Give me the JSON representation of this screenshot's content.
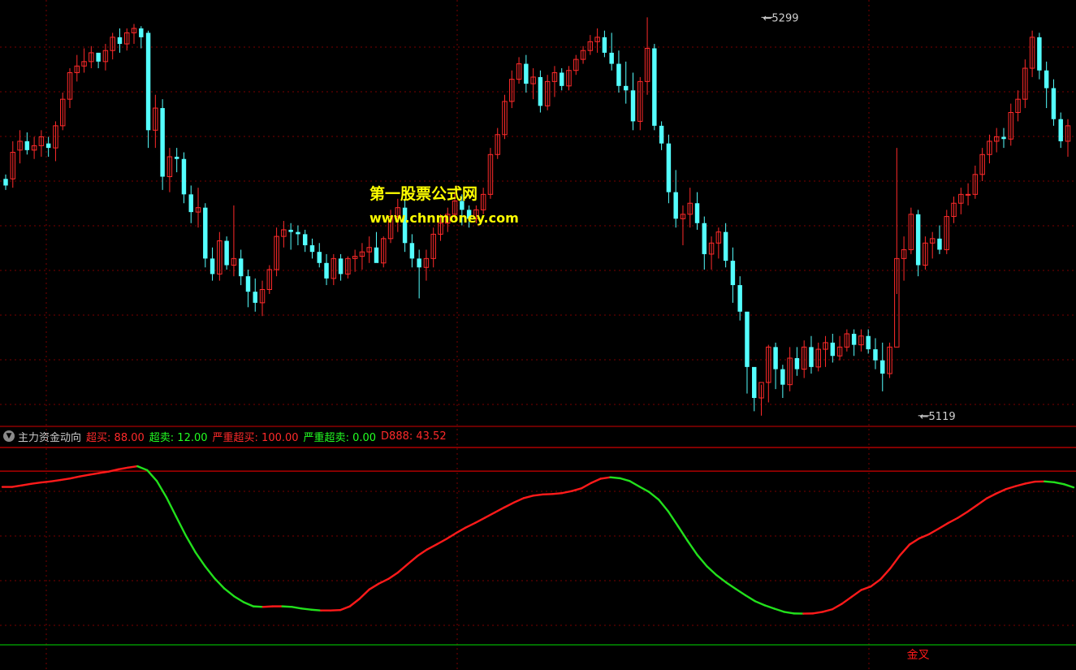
{
  "indicator": {
    "name": "主力资金动向",
    "items": [
      {
        "label": "超买",
        "value": "88.00",
        "color": "#ff2a2a"
      },
      {
        "label": "超卖",
        "value": "12.00",
        "color": "#22ff22"
      },
      {
        "label": "严重超买",
        "value": "100.00",
        "color": "#ff2a2a"
      },
      {
        "label": "严重超卖",
        "value": "0.00",
        "color": "#22ff22"
      },
      {
        "label": "D888",
        "value": "43.52",
        "color": "#ff2a2a"
      }
    ]
  },
  "watermark": {
    "line1": "第一股票公式网",
    "line2": "www.chnmoney.com"
  },
  "colors": {
    "up": "#ff2a2a",
    "down": "#54ffff",
    "osc_up": "#ff1a1a",
    "osc_down": "#22e01c",
    "grid": "#7a0000",
    "band_red": "#d00000",
    "band_green": "#00b000",
    "highlight": "#ffff00"
  },
  "chart_data": [
    {
      "type": "candlestick",
      "title": "",
      "annotations": [
        {
          "label": "5299",
          "value": 5299,
          "kind": "high",
          "index": 106
        },
        {
          "label": "5119",
          "value": 5119,
          "kind": "low",
          "index": 128
        }
      ],
      "ylim": [
        5116,
        5305
      ],
      "grid": true,
      "ohlc": [
        [
          5226,
          5228,
          5221,
          5223
        ],
        [
          5226,
          5243,
          5222,
          5238
        ],
        [
          5239,
          5248,
          5233,
          5243
        ],
        [
          5243,
          5247,
          5237,
          5239
        ],
        [
          5239,
          5245,
          5235,
          5241
        ],
        [
          5241,
          5248,
          5236,
          5245
        ],
        [
          5242,
          5245,
          5236,
          5240
        ],
        [
          5240,
          5252,
          5234,
          5250
        ],
        [
          5250,
          5265,
          5248,
          5262
        ],
        [
          5262,
          5276,
          5258,
          5274
        ],
        [
          5274,
          5282,
          5270,
          5277
        ],
        [
          5277,
          5285,
          5274,
          5279
        ],
        [
          5279,
          5286,
          5276,
          5283
        ],
        [
          5283,
          5283,
          5276,
          5279
        ],
        [
          5279,
          5287,
          5275,
          5284
        ],
        [
          5284,
          5292,
          5280,
          5290
        ],
        [
          5290,
          5294,
          5283,
          5287
        ],
        [
          5287,
          5294,
          5284,
          5292
        ],
        [
          5292,
          5296,
          5287,
          5294
        ],
        [
          5294,
          5295,
          5285,
          5290
        ],
        [
          5292,
          5293,
          5240,
          5248
        ],
        [
          5248,
          5264,
          5240,
          5258
        ],
        [
          5258,
          5262,
          5221,
          5227
        ],
        [
          5227,
          5240,
          5220,
          5236
        ],
        [
          5236,
          5240,
          5229,
          5235
        ],
        [
          5235,
          5238,
          5215,
          5219
        ],
        [
          5219,
          5223,
          5206,
          5211
        ],
        [
          5211,
          5222,
          5204,
          5213
        ],
        [
          5213,
          5215,
          5186,
          5190
        ],
        [
          5190,
          5195,
          5180,
          5183
        ],
        [
          5183,
          5202,
          5180,
          5198
        ],
        [
          5198,
          5200,
          5185,
          5187
        ],
        [
          5187,
          5214,
          5182,
          5190
        ],
        [
          5190,
          5194,
          5178,
          5182
        ],
        [
          5182,
          5185,
          5168,
          5175
        ],
        [
          5175,
          5181,
          5166,
          5170
        ],
        [
          5170,
          5180,
          5164,
          5176
        ],
        [
          5176,
          5187,
          5174,
          5185
        ],
        [
          5185,
          5204,
          5182,
          5200
        ],
        [
          5200,
          5207,
          5195,
          5203
        ],
        [
          5203,
          5206,
          5194,
          5202
        ],
        [
          5202,
          5205,
          5196,
          5201
        ],
        [
          5201,
          5203,
          5193,
          5196
        ],
        [
          5196,
          5199,
          5190,
          5193
        ],
        [
          5193,
          5197,
          5186,
          5188
        ],
        [
          5188,
          5192,
          5178,
          5181
        ],
        [
          5181,
          5192,
          5178,
          5190
        ],
        [
          5190,
          5192,
          5180,
          5183
        ],
        [
          5183,
          5191,
          5181,
          5190
        ],
        [
          5190,
          5194,
          5184,
          5191
        ],
        [
          5191,
          5197,
          5185,
          5193
        ],
        [
          5193,
          5200,
          5188,
          5195
        ],
        [
          5195,
          5202,
          5192,
          5188
        ],
        [
          5188,
          5200,
          5186,
          5199
        ],
        [
          5199,
          5212,
          5197,
          5209
        ],
        [
          5209,
          5217,
          5202,
          5213
        ],
        [
          5213,
          5217,
          5193,
          5197
        ],
        [
          5197,
          5201,
          5186,
          5190
        ],
        [
          5190,
          5194,
          5172,
          5186
        ],
        [
          5186,
          5194,
          5180,
          5190
        ],
        [
          5190,
          5204,
          5186,
          5201
        ],
        [
          5201,
          5210,
          5198,
          5206
        ],
        [
          5206,
          5213,
          5202,
          5210
        ],
        [
          5210,
          5220,
          5208,
          5216
        ],
        [
          5216,
          5219,
          5205,
          5212
        ],
        [
          5212,
          5214,
          5204,
          5208
        ],
        [
          5208,
          5214,
          5206,
          5212
        ],
        [
          5212,
          5222,
          5210,
          5219
        ],
        [
          5219,
          5240,
          5217,
          5237
        ],
        [
          5237,
          5249,
          5235,
          5246
        ],
        [
          5246,
          5264,
          5244,
          5261
        ],
        [
          5261,
          5275,
          5258,
          5271
        ],
        [
          5271,
          5281,
          5269,
          5278
        ],
        [
          5278,
          5282,
          5265,
          5269
        ],
        [
          5269,
          5276,
          5262,
          5272
        ],
        [
          5272,
          5275,
          5256,
          5259
        ],
        [
          5259,
          5273,
          5257,
          5270
        ],
        [
          5270,
          5277,
          5263,
          5274
        ],
        [
          5274,
          5276,
          5266,
          5268
        ],
        [
          5268,
          5277,
          5266,
          5275
        ],
        [
          5275,
          5282,
          5273,
          5280
        ],
        [
          5280,
          5286,
          5278,
          5284
        ],
        [
          5284,
          5291,
          5282,
          5288
        ],
        [
          5288,
          5294,
          5283,
          5290
        ],
        [
          5290,
          5293,
          5281,
          5283
        ],
        [
          5283,
          5292,
          5275,
          5278
        ],
        [
          5278,
          5284,
          5265,
          5268
        ],
        [
          5268,
          5279,
          5260,
          5266
        ],
        [
          5266,
          5274,
          5248,
          5252
        ],
        [
          5252,
          5272,
          5248,
          5270
        ],
        [
          5270,
          5299,
          5264,
          5285
        ],
        [
          5285,
          5287,
          5248,
          5250
        ],
        [
          5250,
          5252,
          5239,
          5242
        ],
        [
          5242,
          5246,
          5215,
          5220
        ],
        [
          5220,
          5230,
          5204,
          5208
        ],
        [
          5208,
          5214,
          5196,
          5210
        ],
        [
          5210,
          5222,
          5204,
          5215
        ],
        [
          5215,
          5220,
          5203,
          5206
        ],
        [
          5206,
          5209,
          5185,
          5192
        ],
        [
          5192,
          5200,
          5185,
          5197
        ],
        [
          5197,
          5204,
          5190,
          5202
        ],
        [
          5202,
          5206,
          5186,
          5189
        ],
        [
          5189,
          5195,
          5170,
          5178
        ],
        [
          5178,
          5182,
          5162,
          5166
        ],
        [
          5166,
          5162,
          5129,
          5141
        ],
        [
          5141,
          5140,
          5121,
          5127
        ],
        [
          5127,
          5133,
          5119,
          5134
        ],
        [
          5134,
          5151,
          5125,
          5150
        ],
        [
          5150,
          5152,
          5131,
          5140
        ],
        [
          5140,
          5142,
          5127,
          5133
        ],
        [
          5133,
          5150,
          5130,
          5145
        ],
        [
          5145,
          5150,
          5137,
          5140
        ],
        [
          5140,
          5153,
          5136,
          5150
        ],
        [
          5150,
          5155,
          5138,
          5141
        ],
        [
          5141,
          5152,
          5139,
          5149
        ],
        [
          5149,
          5155,
          5141,
          5152
        ],
        [
          5152,
          5156,
          5143,
          5146
        ],
        [
          5146,
          5155,
          5144,
          5150
        ],
        [
          5150,
          5158,
          5148,
          5156
        ],
        [
          5156,
          5158,
          5146,
          5151
        ],
        [
          5151,
          5158,
          5148,
          5155
        ],
        [
          5155,
          5158,
          5147,
          5149
        ],
        [
          5149,
          5154,
          5140,
          5144
        ],
        [
          5144,
          5152,
          5130,
          5138
        ],
        [
          5138,
          5152,
          5136,
          5150
        ],
        [
          5150,
          5240,
          5174,
          5190
        ],
        [
          5190,
          5200,
          5180,
          5194
        ],
        [
          5194,
          5213,
          5192,
          5210
        ],
        [
          5210,
          5212,
          5182,
          5187
        ],
        [
          5187,
          5200,
          5185,
          5197
        ],
        [
          5197,
          5202,
          5190,
          5199
        ],
        [
          5199,
          5205,
          5192,
          5194
        ],
        [
          5194,
          5212,
          5192,
          5209
        ],
        [
          5209,
          5218,
          5206,
          5215
        ],
        [
          5215,
          5222,
          5210,
          5219
        ],
        [
          5219,
          5224,
          5214,
          5219
        ],
        [
          5219,
          5232,
          5217,
          5228
        ],
        [
          5228,
          5240,
          5225,
          5237
        ],
        [
          5237,
          5246,
          5233,
          5243
        ],
        [
          5243,
          5249,
          5238,
          5245
        ],
        [
          5245,
          5249,
          5240,
          5244
        ],
        [
          5244,
          5260,
          5241,
          5256
        ],
        [
          5256,
          5266,
          5252,
          5262
        ],
        [
          5262,
          5280,
          5258,
          5276
        ],
        [
          5276,
          5293,
          5272,
          5290
        ],
        [
          5290,
          5292,
          5271,
          5275
        ],
        [
          5275,
          5279,
          5258,
          5267
        ],
        [
          5267,
          5271,
          5250,
          5253
        ],
        [
          5253,
          5256,
          5240,
          5243
        ],
        [
          5243,
          5253,
          5236,
          5250
        ]
      ]
    },
    {
      "type": "line",
      "title": "主力资金动向",
      "ylim": [
        0,
        100
      ],
      "reference_lines": [
        {
          "label": "严重超买",
          "value": 100,
          "color": "#d00000"
        },
        {
          "label": "超买",
          "value": 88,
          "color": "#d00000"
        },
        {
          "label": "超卖",
          "value": 12,
          "color": "#00b000"
        },
        {
          "label": "严重超卖",
          "value": 0,
          "color": "#00b000"
        }
      ],
      "annotations": [
        {
          "label": "金叉",
          "index": 128
        }
      ],
      "series": [
        {
          "name": "D888",
          "values": [
            80,
            80,
            80.8,
            81.6,
            82.3,
            82.8,
            83.5,
            84.3,
            85.3,
            86.2,
            87,
            87.8,
            88.9,
            89.8,
            90.5,
            88.5,
            83,
            74.7,
            65,
            55.4,
            46.9,
            39.8,
            33.6,
            28.5,
            24.6,
            21.6,
            19.5,
            19.2,
            19.5,
            19.5,
            19.2,
            18.4,
            17.8,
            17.4,
            17.4,
            17.6,
            19.5,
            23.3,
            28,
            31,
            33.4,
            36.7,
            40.9,
            45,
            48.3,
            50.9,
            53.6,
            56.6,
            59.4,
            61.8,
            64.4,
            67,
            69.6,
            72.1,
            74.3,
            75.6,
            76.2,
            76.4,
            76.9,
            77.9,
            79.3,
            82,
            84.2,
            84.9,
            84.4,
            83,
            80.2,
            77.5,
            73.6,
            67.6,
            60.2,
            52.7,
            45.6,
            39.8,
            35.3,
            31.6,
            28.3,
            25.1,
            22.1,
            20,
            18.3,
            16.7,
            15.9,
            15.8,
            15.9,
            16.7,
            18,
            20.8,
            24.3,
            27.8,
            29.6,
            33.2,
            38.7,
            45.3,
            50.8,
            53.9,
            56,
            58.8,
            61.7,
            64.3,
            67.4,
            70.8,
            74.2,
            76.7,
            78.9,
            80.4,
            81.7,
            82.7,
            82.8,
            82.4,
            81.4,
            79.8
          ]
        }
      ]
    }
  ]
}
